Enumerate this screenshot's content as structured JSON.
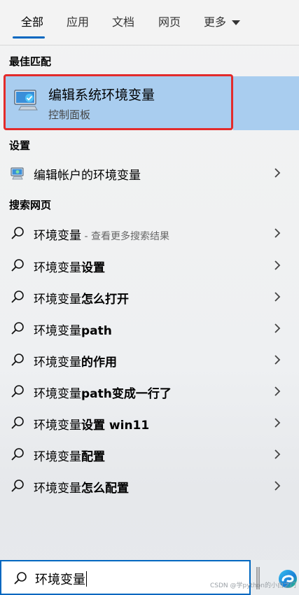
{
  "tabs": {
    "items": [
      "全部",
      "应用",
      "文档",
      "网页",
      "更多"
    ],
    "active": "全部"
  },
  "best_match": {
    "section_title": "最佳匹配",
    "title": "编辑系统环境变量",
    "subtitle": "控制面板",
    "icon": "monitor-checkmark-icon"
  },
  "settings": {
    "section_title": "设置",
    "items": [
      {
        "label": "编辑帐户的环境变量",
        "icon": "monitor-settings-icon"
      }
    ]
  },
  "web": {
    "section_title": "搜索网页",
    "items": [
      {
        "prefix": "环境变量",
        "bold": "",
        "note": " - 查看更多搜索结果"
      },
      {
        "prefix": "环境变量",
        "bold": "设置",
        "note": ""
      },
      {
        "prefix": "环境变量",
        "bold": "怎么打开",
        "note": ""
      },
      {
        "prefix": "环境变量",
        "bold": "path",
        "note": ""
      },
      {
        "prefix": "环境变量",
        "bold": "的作用",
        "note": ""
      },
      {
        "prefix": "环境变量",
        "bold": "path变成一行了",
        "note": ""
      },
      {
        "prefix": "环境变量",
        "bold": "设置 win11",
        "note": ""
      },
      {
        "prefix": "环境变量",
        "bold": "配置",
        "note": ""
      },
      {
        "prefix": "环境变量",
        "bold": "怎么配置",
        "note": ""
      }
    ]
  },
  "search": {
    "value": "环境变量",
    "icon": "search-icon"
  },
  "watermark": "CSDN @学python的小白之门",
  "colors": {
    "accent": "#0067c0",
    "highlight": "#a9cdef",
    "selection_border": "#e32b2b"
  }
}
